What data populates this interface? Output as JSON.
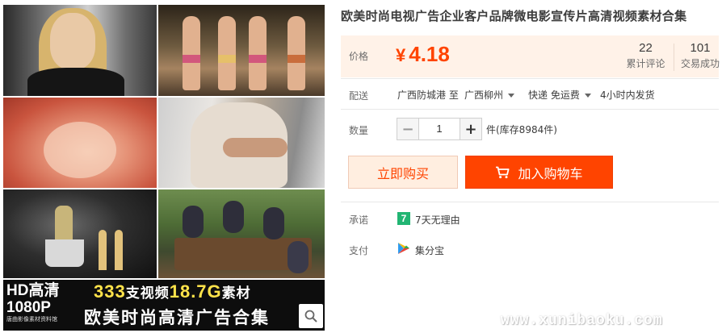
{
  "product": {
    "title": "欧美时尚电视广告企业客户品牌微电影宣传片高清视频素材合集"
  },
  "gallery": {
    "banner_hd": "HD高清",
    "banner_1080": "1080P",
    "banner_brand": "唐曲影像素材资料馆",
    "banner_count_num": "333",
    "banner_count_unit": "支视频",
    "banner_size": "18.7G",
    "banner_size_unit": "素材",
    "banner_line2": "欧美时尚高清广告合集",
    "zoom_icon": "magnifier-icon"
  },
  "price": {
    "label": "价格",
    "currency": "¥",
    "value": "4.18",
    "reviews_count": "22",
    "reviews_label": "累计评论",
    "sold_count": "101",
    "sold_label": "交易成功"
  },
  "shipping": {
    "label": "配送",
    "from": "广西防城港 至",
    "to": "广西柳州",
    "method": "快递 免运费",
    "dispatch": "4小时内发货"
  },
  "quantity": {
    "label": "数量",
    "minus": "−",
    "value": "1",
    "plus": "+",
    "stock": "件(库存8984件)"
  },
  "actions": {
    "buy_now": "立即购买",
    "add_to_cart": "加入购物车",
    "cart_icon": "cart-icon"
  },
  "promise": {
    "label": "承诺",
    "icon_text": "7",
    "text": "7天无理由"
  },
  "payment": {
    "label": "支付",
    "text": "集分宝"
  },
  "watermark": "www.xunibaoku.com",
  "colors": {
    "accent": "#ff4400",
    "price_bg": "#fff2e8",
    "promise_green": "#22b573"
  }
}
